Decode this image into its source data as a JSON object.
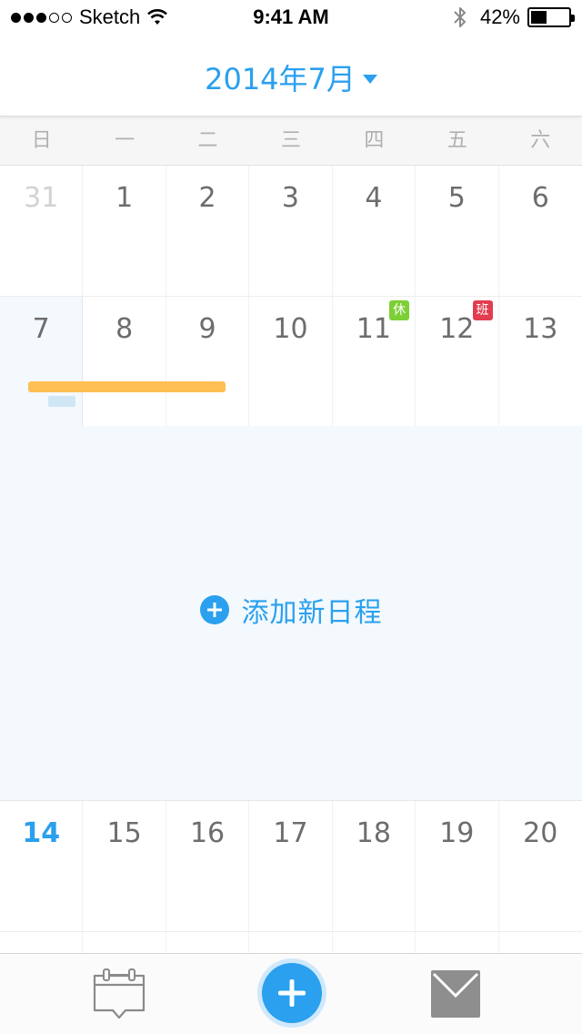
{
  "status_bar": {
    "carrier": "Sketch",
    "signal_bars_filled": 3,
    "signal_bars_total": 5,
    "time": "9:41 AM",
    "battery_percent": "42%",
    "battery_level": 0.42
  },
  "header": {
    "month_title": "2014年7月"
  },
  "weekdays": [
    "日",
    "一",
    "二",
    "三",
    "四",
    "五",
    "六"
  ],
  "weeks": [
    [
      "31",
      "1",
      "2",
      "3",
      "4",
      "5",
      "6"
    ],
    [
      "7",
      "8",
      "9",
      "10",
      "11",
      "12",
      "13"
    ],
    [
      "14",
      "15",
      "16",
      "17",
      "18",
      "19",
      "20"
    ]
  ],
  "tags": {
    "rest": "休",
    "work": "班"
  },
  "day_panel": {
    "add_label": "添加新日程"
  },
  "colors": {
    "accent": "#2aa0ef",
    "event": "#ffbf52",
    "rest_tag": "#7ccf35",
    "work_tag": "#e23d4f",
    "selected_bg": "#f3f9fd"
  },
  "icons": {
    "tab_calendar": "calendar-chat-icon",
    "tab_add": "plus-icon",
    "tab_mail": "mail-icon"
  }
}
